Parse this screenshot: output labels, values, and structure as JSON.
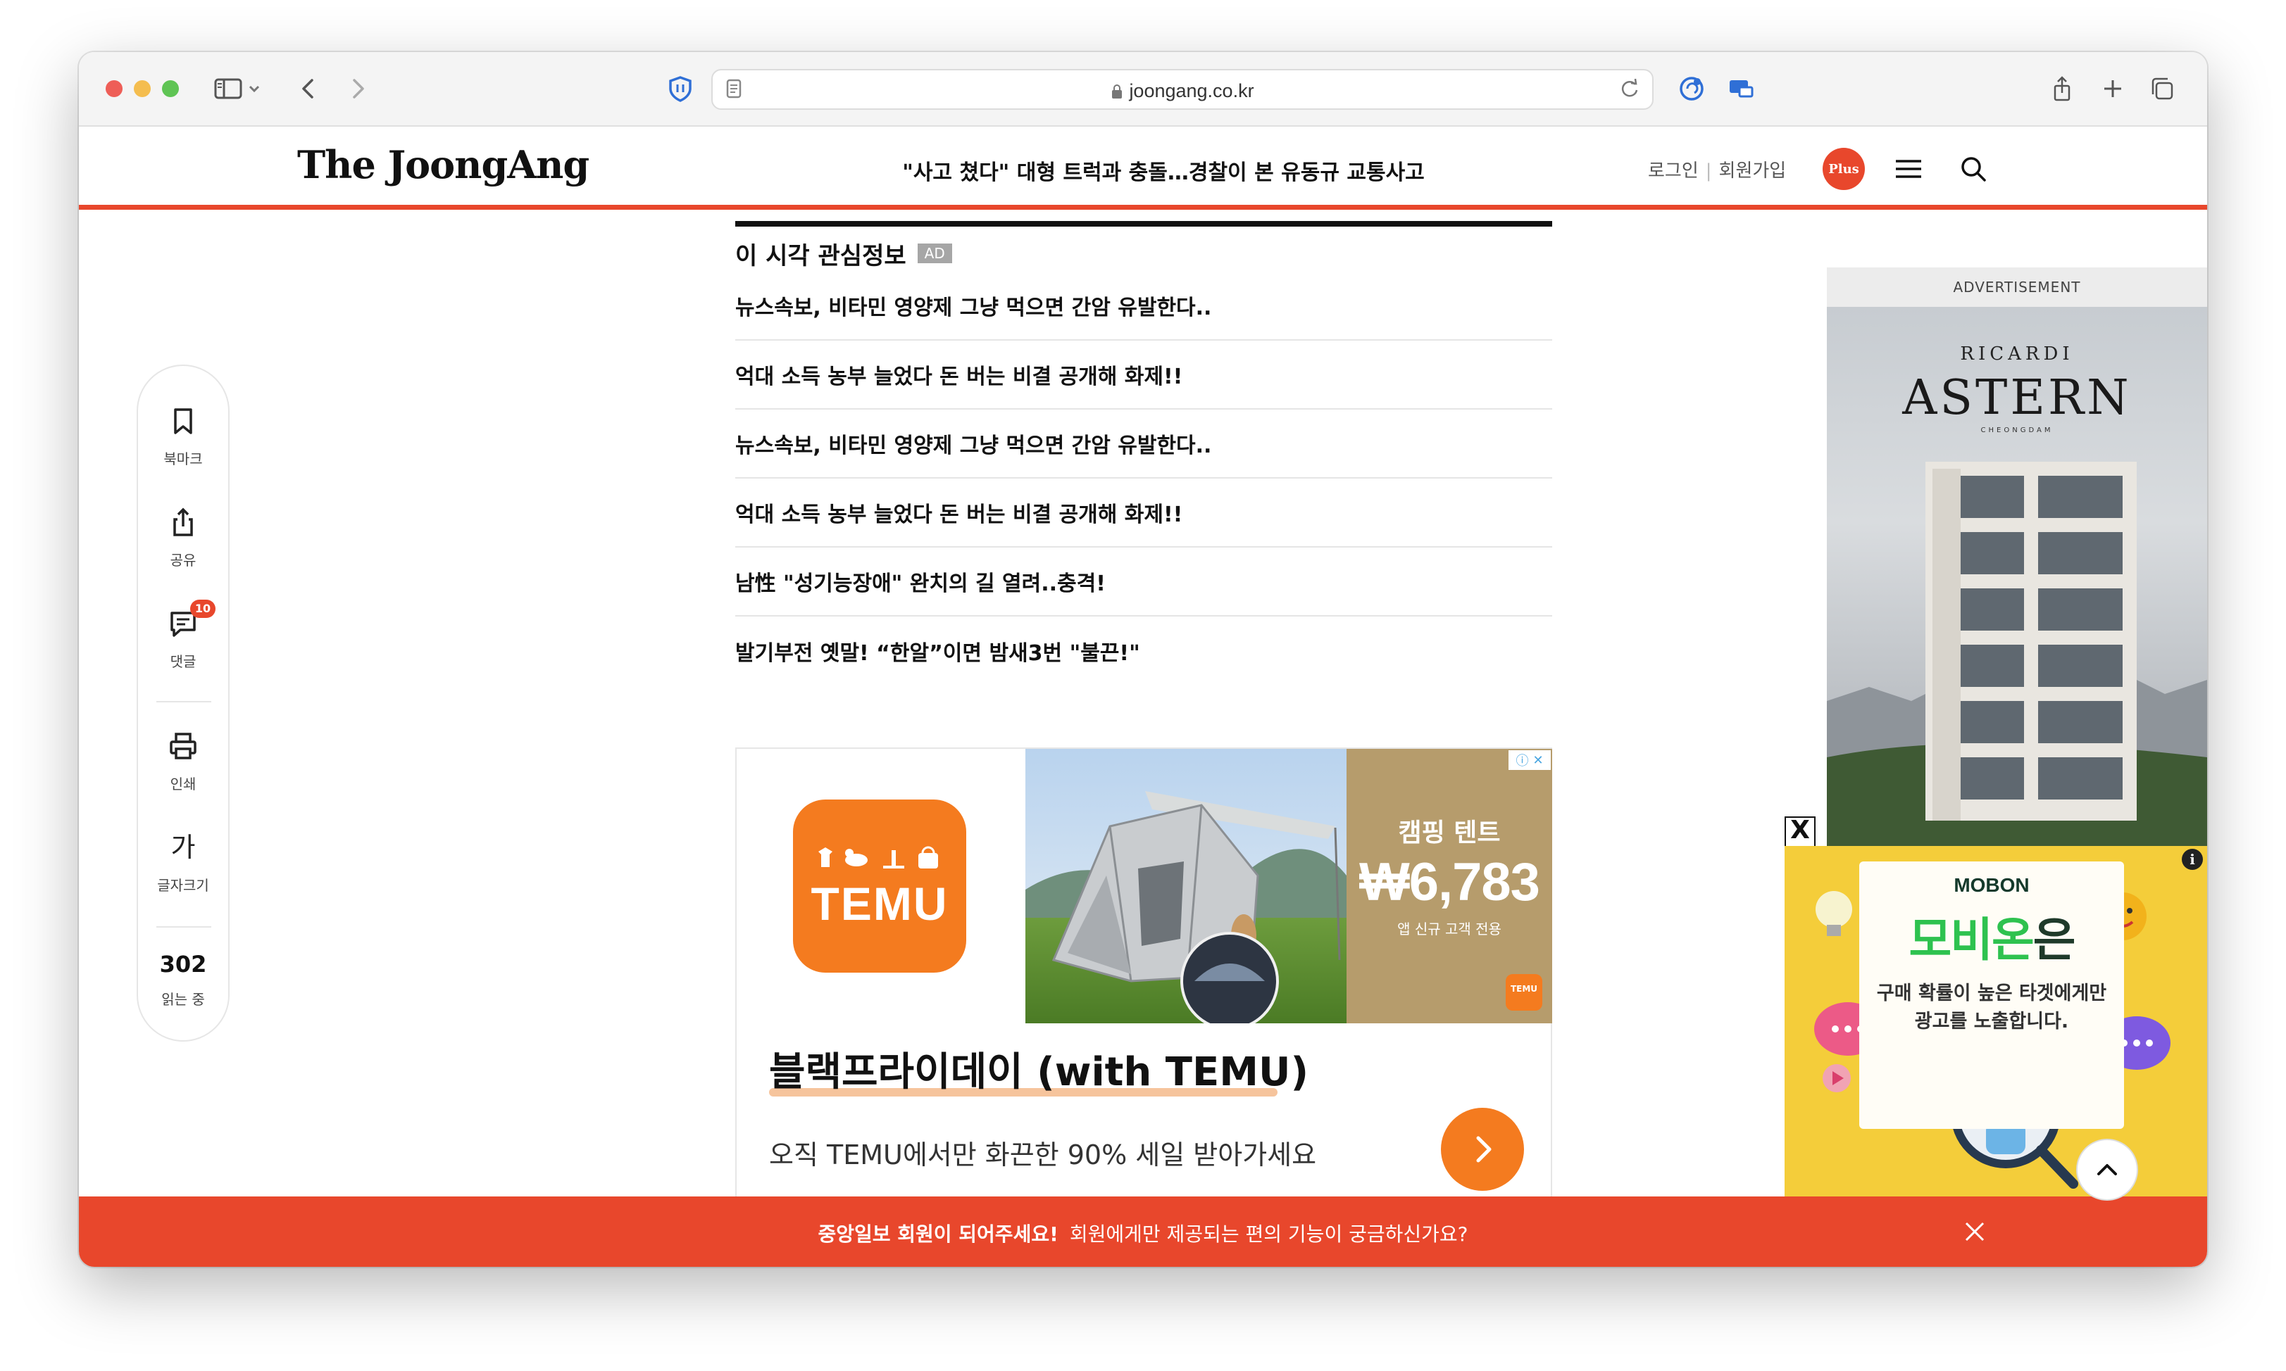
{
  "browser": {
    "url": "joongang.co.kr",
    "colors": {
      "traffic_red": "#ee5e57",
      "traffic_yellow": "#f4bd4f",
      "traffic_green": "#5fc454"
    },
    "icons": [
      "sidebar-icon",
      "chevron-down-icon",
      "back-icon",
      "forward-icon",
      "shield-icon",
      "reader-icon",
      "lock-icon",
      "reload-icon",
      "extension-icon",
      "screen-mirror-icon",
      "share-icon",
      "new-tab-icon",
      "tabs-overview-icon"
    ]
  },
  "header": {
    "logo": "The JoongAng",
    "headline": "\"사고 쳤다\" 대형 트럭과 충돌…경찰이 본 유동규 교통사고",
    "login": "로그인",
    "signup": "회원가입",
    "plus_badge": "Plus",
    "accent": "#e8472c"
  },
  "rail": {
    "bookmark": "북마크",
    "share": "공유",
    "comments": "댓글",
    "comment_count": "10",
    "print": "인쇄",
    "font_glyph": "가",
    "font_size": "글자크기",
    "readers": "302",
    "readers_label": "읽는 중"
  },
  "interest": {
    "title": "이 시각 관심정보",
    "ad_tag": "AD",
    "items": [
      "뉴스속보, 비타민 영양제 그냥 먹으면 간암 유발한다..",
      "억대 소득 농부 늘었다 돈 버는 비결 공개해 화제!!",
      "뉴스속보, 비타민 영양제 그냥 먹으면 간암 유발한다..",
      "억대 소득 농부 늘었다 돈 버는 비결 공개해 화제!!",
      "남性 \"성기능장애\" 완치의 길 열려..충격!",
      "발기부전 옛말! “한알”이면 밤새3번 \"불끈!\""
    ]
  },
  "temu_ad": {
    "logo_text": "TEMU",
    "panel_title": "캠핑 텐트",
    "panel_price": "₩6,783",
    "panel_note": "앱 신규 고객 전용",
    "chip_text": "TEMU",
    "headline": "블랙프라이데이 (with TEMU)",
    "subtext": "오직 TEMU에서만 화끈한 90% 세일 받아가세요",
    "brand_color": "#f47b1f"
  },
  "right_ads": {
    "label": "ADVERTISEMENT",
    "astern_brand": "RICARDI",
    "astern_title": "ASTERN",
    "astern_sub": "CHEONGDAM",
    "close_glyph": "X",
    "mobon_brand": "MOBON",
    "mobon_title_main": "모비온",
    "mobon_title_suffix": "은",
    "mobon_line1": "구매 확률이 높은 타겟에게만",
    "mobon_line2": "광고를 노출합니다.",
    "info": "i"
  },
  "banner": {
    "bold": "중앙일보 회원이 되어주세요!",
    "text": "회원에게만 제공되는 편의 기능이 궁금하신가요?"
  }
}
